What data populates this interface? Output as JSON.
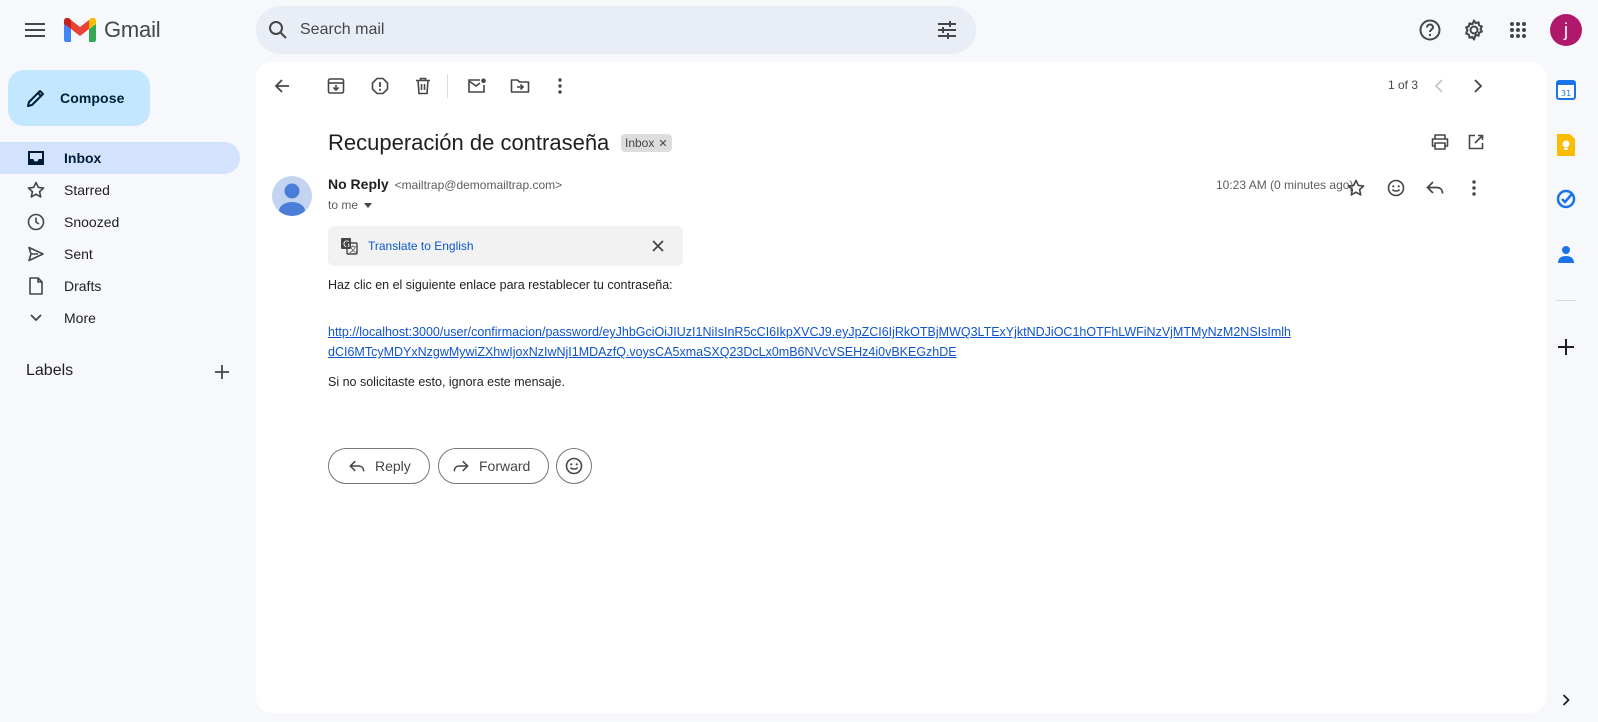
{
  "app": {
    "name": "Gmail"
  },
  "search": {
    "placeholder": "Search mail"
  },
  "user": {
    "initial": "j",
    "avatar_color": "#b0186b"
  },
  "sidebar": {
    "compose_label": "Compose",
    "items": [
      {
        "label": "Inbox",
        "icon": "inbox-icon",
        "active": true
      },
      {
        "label": "Starred",
        "icon": "star-icon"
      },
      {
        "label": "Snoozed",
        "icon": "clock-icon"
      },
      {
        "label": "Sent",
        "icon": "send-icon"
      },
      {
        "label": "Drafts",
        "icon": "draft-icon"
      },
      {
        "label": "More",
        "icon": "chevron-down-icon"
      }
    ],
    "labels_title": "Labels"
  },
  "toolbar": {
    "pager": "1 of 3"
  },
  "email": {
    "subject": "Recuperación de contraseña",
    "label_chip": "Inbox",
    "sender_name": "No Reply",
    "sender_email": "<mailtrap@demomailtrap.com>",
    "recipient": "to me",
    "timestamp": "10:23 AM (0 minutes ago)",
    "translate_label": "Translate to English",
    "body_line1": "Haz clic en el siguiente enlace para restablecer tu contraseña:",
    "link_line1": "http://localhost:3000/user/confirmacion/password/eyJhbGciOiJIUzI1NiIsInR5cCI6IkpXVCJ9.eyJpZCI6IjRkOTBjMWQ3LTExYjktNDJiOC1hOTFhLWFiNzVjMTMyNzM2NSIsImlh",
    "link_line2": "dCI6MTcyMDYxNzgwMywiZXhwIjoxNzIwNjI1MDAzfQ.voysCA5xmaSXQ23DcLx0mB6NVcVSEHz4i0vBKEGzhDE",
    "body_line2": "Si no solicitaste esto, ignora este mensaje."
  },
  "actions": {
    "reply_label": "Reply",
    "forward_label": "Forward"
  },
  "colors": {
    "accent": "#0b57d0",
    "compose_bg": "#c2e7ff",
    "active_nav": "#d3e3fd"
  }
}
